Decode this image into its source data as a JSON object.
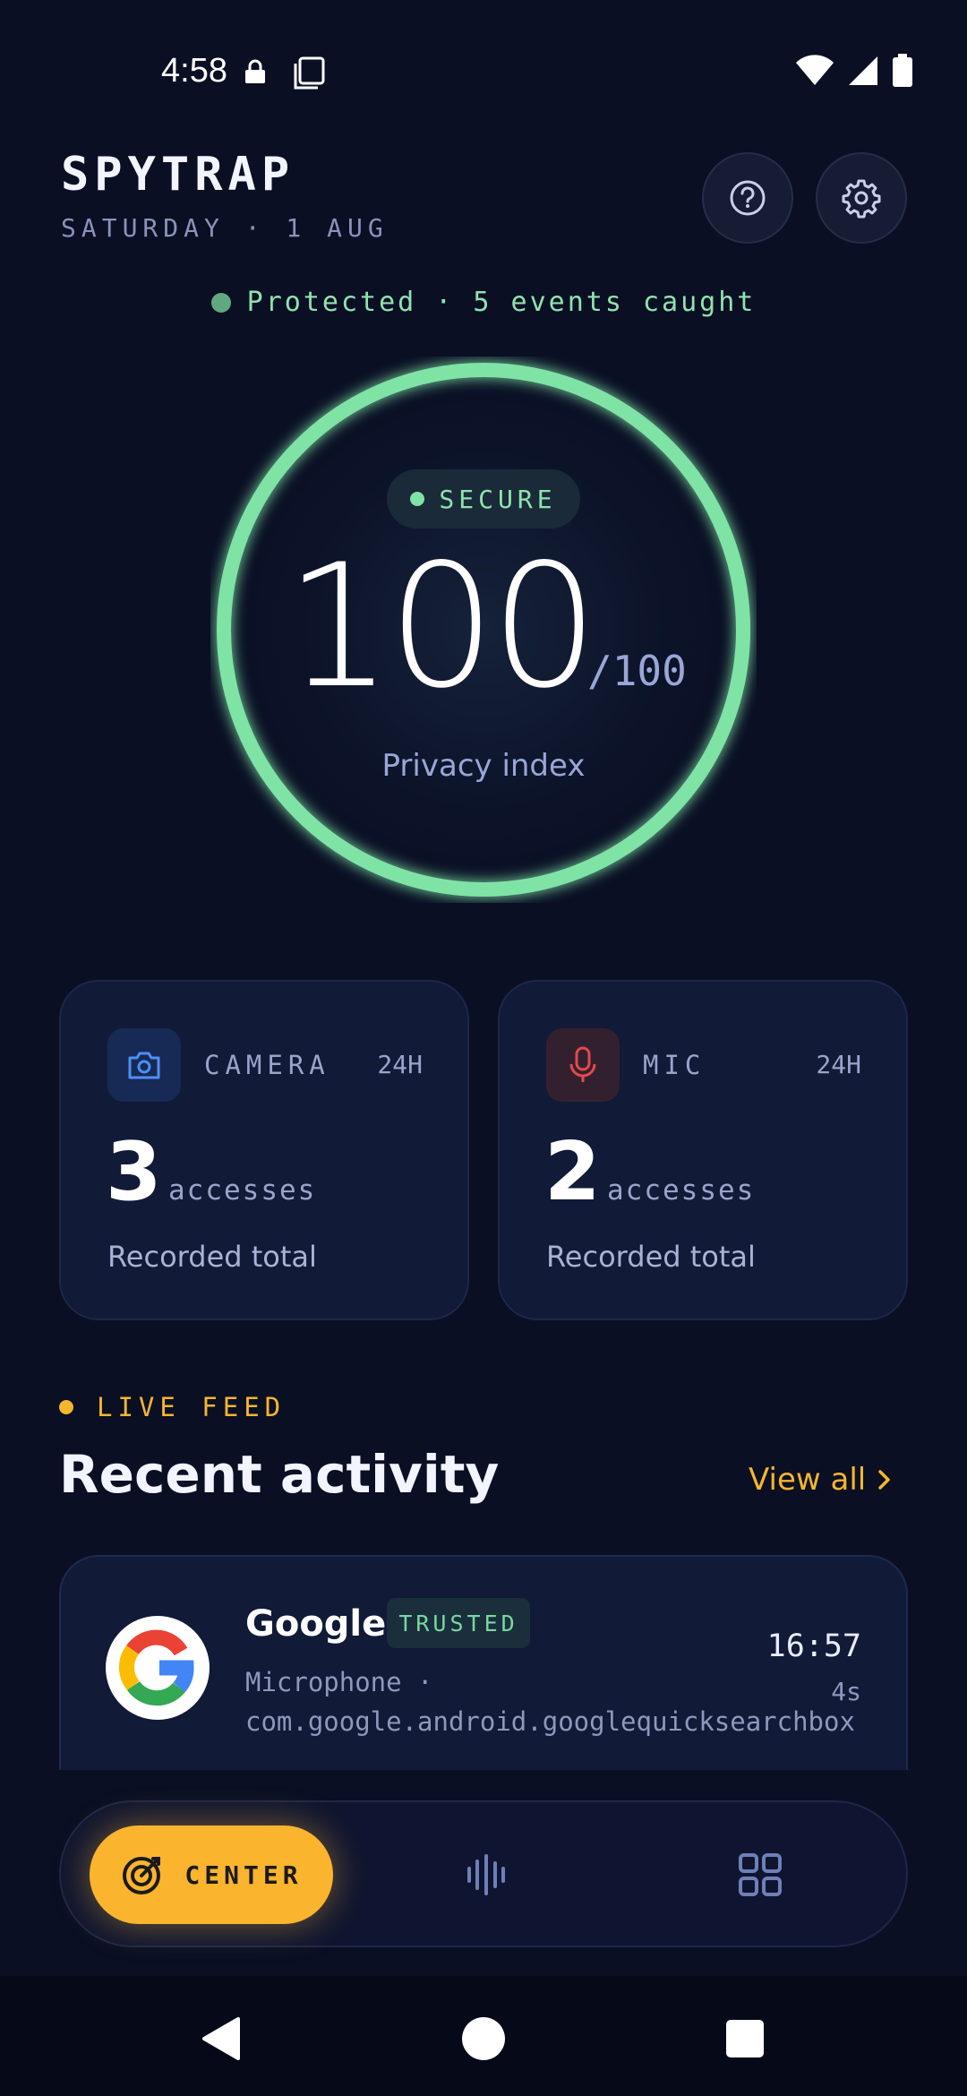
{
  "status_bar": {
    "time": "4:58"
  },
  "header": {
    "app_title": "SPYTRAP",
    "date": "SATURDAY · 1 AUG"
  },
  "summary": {
    "status_text": "Protected · 5 events caught"
  },
  "score": {
    "badge": "SECURE",
    "value": "100",
    "max": "/100",
    "label": "Privacy index",
    "ring_fraction": 1.0
  },
  "stats": {
    "camera": {
      "label": "CAMERA",
      "period": "24H",
      "count": "3",
      "unit": "accesses",
      "footer": "Recorded total"
    },
    "mic": {
      "label": "MIC",
      "period": "24H",
      "count": "2",
      "unit": "accesses",
      "footer": "Recorded total"
    }
  },
  "feed": {
    "live_label": "LIVE FEED",
    "title": "Recent activity",
    "view_all": "View all",
    "items": [
      {
        "app": "Google",
        "badge": "TRUSTED",
        "description": "Microphone · com.google.android.googlequicksearchbox",
        "time": "16:57",
        "duration": "4s",
        "icon": "google-logo"
      }
    ]
  },
  "nav": {
    "center_label": "CENTER",
    "center_icon": "target-icon",
    "audio_icon": "audio-wave-icon",
    "grid_icon": "grid-icon"
  },
  "colors": {
    "background": "#0a0f24",
    "accent": "#fbb42e",
    "secure": "#7fe3a6",
    "camera": "#3b82f6",
    "mic": "#e5484d"
  }
}
